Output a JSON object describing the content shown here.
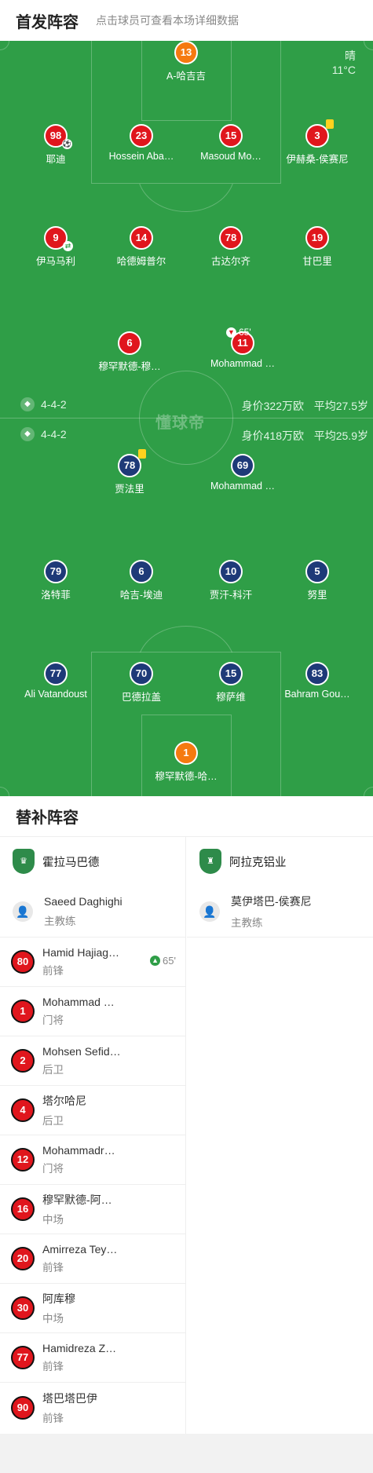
{
  "header": {
    "title": "首发阵容",
    "subtitle": "点击球员可查看本场详细数据"
  },
  "weather": {
    "condition": "晴",
    "temperature": "11°C"
  },
  "watermark": "懂球帝",
  "home_team": {
    "name": "霍拉马巴德",
    "formation": "4-4-2",
    "market_value": "身价322万欧",
    "avg_age": "平均27.5岁",
    "color": "#e0161d",
    "goalkeeper": {
      "number": "13",
      "name": "A-哈吉吉"
    },
    "defenders": [
      {
        "number": "98",
        "name": "耶迪"
      },
      {
        "number": "23",
        "name": "Hossein Aba…"
      },
      {
        "number": "15",
        "name": "Masoud Mo…"
      },
      {
        "number": "3",
        "name": "伊赫桑-侯赛尼"
      }
    ],
    "midfielders": [
      {
        "number": "9",
        "name": "伊马马利"
      },
      {
        "number": "14",
        "name": "哈德姆普尔"
      },
      {
        "number": "78",
        "name": "古达尔齐"
      },
      {
        "number": "19",
        "name": "甘巴里"
      }
    ],
    "forwards": [
      {
        "number": "6",
        "name": "穆罕默德-穆…"
      },
      {
        "number": "11",
        "name": "Mohammad …",
        "sub_off_minute": "65'"
      }
    ]
  },
  "away_team": {
    "name": "阿拉克铝业",
    "formation": "4-4-2",
    "market_value": "身价418万欧",
    "avg_age": "平均25.9岁",
    "color": "#1e3a78",
    "forwards": [
      {
        "number": "78",
        "name": "贾法里"
      },
      {
        "number": "69",
        "name": "Mohammad …"
      }
    ],
    "midfielders": [
      {
        "number": "79",
        "name": "洛特菲"
      },
      {
        "number": "6",
        "name": "哈吉-埃迪"
      },
      {
        "number": "10",
        "name": "贾汗-科汗"
      },
      {
        "number": "5",
        "name": "努里"
      }
    ],
    "defenders": [
      {
        "number": "77",
        "name": "Ali Vatandoust"
      },
      {
        "number": "70",
        "name": "巴德拉盖"
      },
      {
        "number": "15",
        "name": "穆萨维"
      },
      {
        "number": "83",
        "name": "Bahram Gou…"
      }
    ],
    "goalkeeper": {
      "number": "1",
      "name": "穆罕默德-哈…"
    }
  },
  "subs": {
    "title": "替补阵容",
    "home": {
      "team_name": "霍拉马巴德",
      "coach": {
        "name": "Saeed Daghighi",
        "role": "主教练"
      },
      "players": [
        {
          "number": "80",
          "name": "Hamid Hajiag…",
          "position": "前锋",
          "sub_in": "65'"
        },
        {
          "number": "1",
          "name": "Mohammad …",
          "position": "门将"
        },
        {
          "number": "2",
          "name": "Mohsen Sefid…",
          "position": "后卫"
        },
        {
          "number": "4",
          "name": "塔尔哈尼",
          "position": "后卫"
        },
        {
          "number": "12",
          "name": "Mohammadr…",
          "position": "门将"
        },
        {
          "number": "16",
          "name": "穆罕默德-阿…",
          "position": "中场"
        },
        {
          "number": "20",
          "name": "Amirreza Tey…",
          "position": "前锋"
        },
        {
          "number": "30",
          "name": "阿库穆",
          "position": "中场"
        },
        {
          "number": "77",
          "name": "Hamidreza Z…",
          "position": "前锋"
        },
        {
          "number": "90",
          "name": "塔巴塔巴伊",
          "position": "前锋"
        }
      ]
    },
    "away": {
      "team_name": "阿拉克铝业",
      "coach": {
        "name": "莫伊塔巴-侯赛尼",
        "role": "主教练"
      }
    }
  }
}
